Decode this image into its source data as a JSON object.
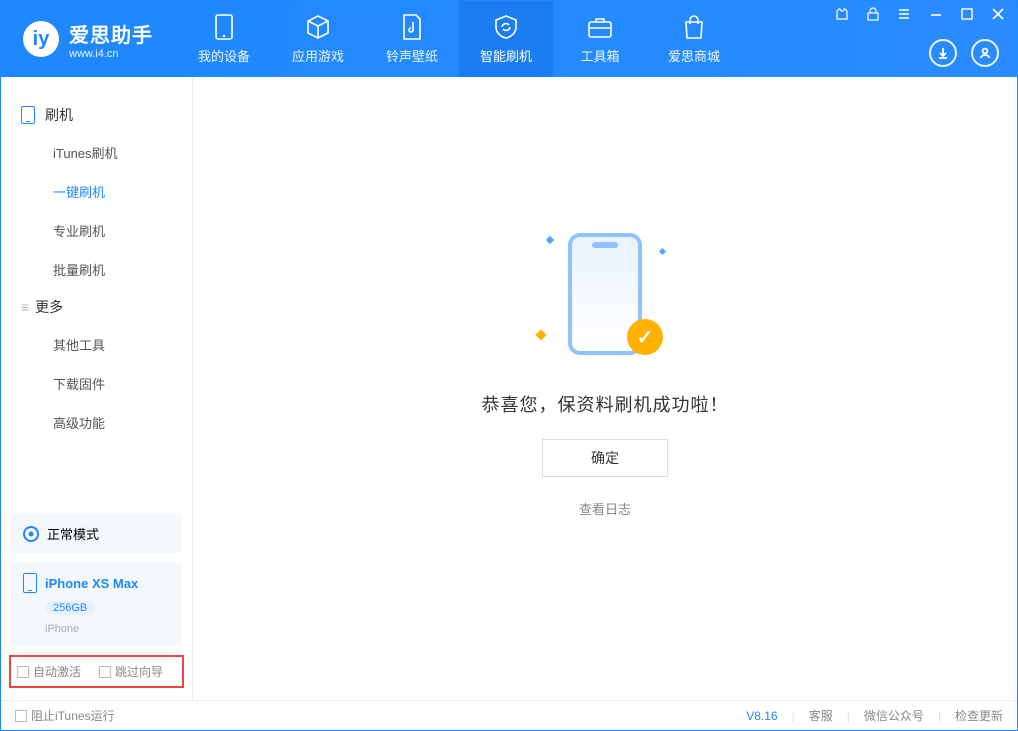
{
  "brand": {
    "cn": "爱思助手",
    "sub": "www.i4.cn"
  },
  "nav": {
    "device": "我的设备",
    "apps": "应用游戏",
    "ring": "铃声壁纸",
    "flash": "智能刷机",
    "tools": "工具箱",
    "store": "爱思商城"
  },
  "sidebar": {
    "group_flash": "刷机",
    "items_flash": {
      "itunes": "iTunes刷机",
      "onekey": "一键刷机",
      "pro": "专业刷机",
      "batch": "批量刷机"
    },
    "group_more": "更多",
    "items_more": {
      "other": "其他工具",
      "firmware": "下载固件",
      "advanced": "高级功能"
    },
    "mode": "正常模式",
    "device": {
      "name": "iPhone XS Max",
      "capacity": "256GB",
      "type": "iPhone"
    },
    "opts": {
      "auto_activate": "自动激活",
      "skip_guide": "跳过向导"
    }
  },
  "main": {
    "message": "恭喜您，保资料刷机成功啦！",
    "ok": "确定",
    "view_log": "查看日志"
  },
  "footer": {
    "block_itunes": "阻止iTunes运行",
    "version": "V8.16",
    "support": "客服",
    "wechat": "微信公众号",
    "update": "检查更新"
  }
}
